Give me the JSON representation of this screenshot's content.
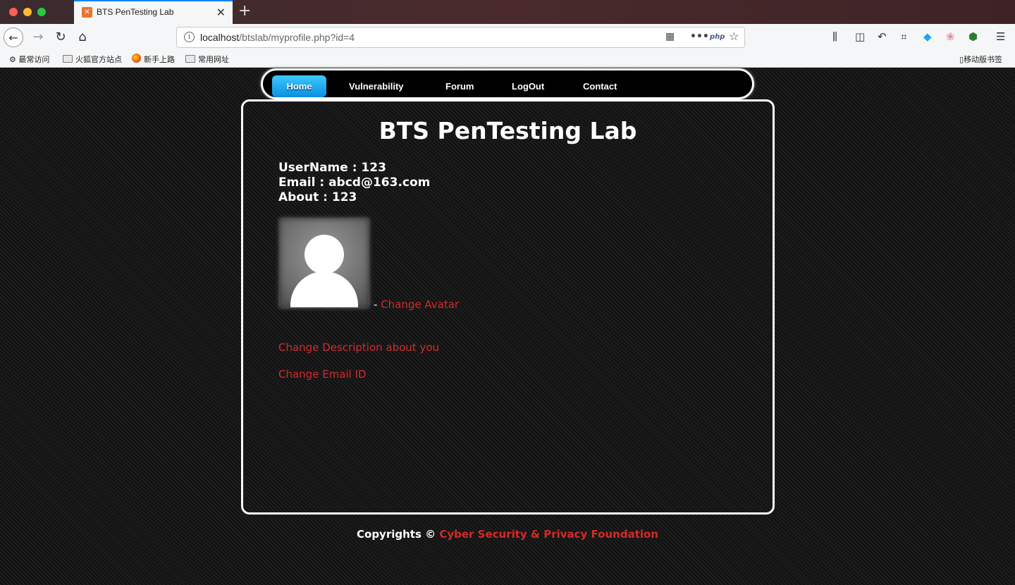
{
  "browser": {
    "tab_title": "BTS PenTesting Lab",
    "tab_close": "✕",
    "new_tab": "+",
    "url_host": "localhost",
    "url_path": "/btslab/myprofile.php?id=4",
    "php_badge": "php",
    "bookmarks": [
      "最常访问",
      "火狐官方站点",
      "新手上路",
      "常用网址"
    ],
    "mobile_bookmarks": "移动版书签"
  },
  "menu": {
    "items": [
      "Home",
      "Vulnerability",
      "Forum",
      "LogOut",
      "Contact"
    ],
    "active": "Home"
  },
  "page": {
    "title": "BTS PenTesting Lab",
    "username_label": "UserName : 123",
    "email_label": "Email : abcd@163.com",
    "about_label": "About : 123",
    "avatar_separator": "- ",
    "change_avatar": "Change Avatar",
    "change_description": "Change Description about you",
    "change_email": "Change Email ID"
  },
  "footer": {
    "prefix": "Copyrights © ",
    "org": "Cyber Security & Privacy Foundation"
  },
  "colors": {
    "link": "#d42a2a",
    "active_menu": "#0a8fe0",
    "border": "#ffffff"
  }
}
